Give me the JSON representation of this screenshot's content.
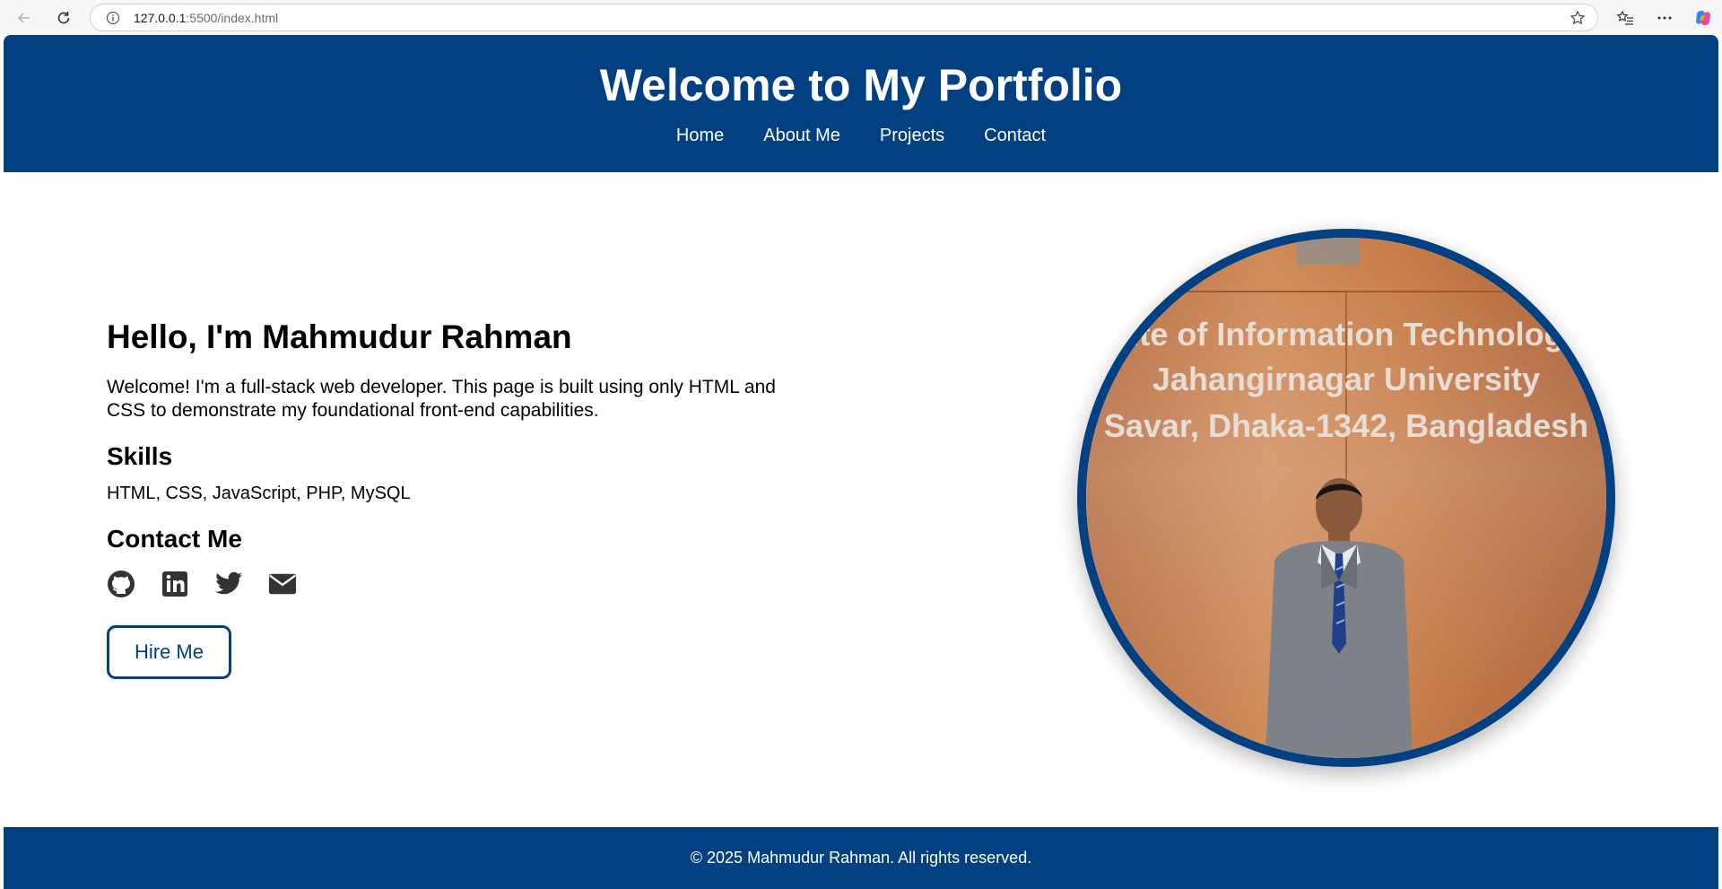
{
  "browser": {
    "url_host": "127.0.0.1",
    "url_rest": ":5500/index.html",
    "icons": [
      "back-arrow-icon",
      "reload-icon",
      "site-info-icon",
      "favorite-star-icon",
      "favorites-icon",
      "more-icon",
      "copilot-icon"
    ]
  },
  "header": {
    "title": "Welcome to My Portfolio",
    "nav": [
      {
        "label": "Home"
      },
      {
        "label": "About Me"
      },
      {
        "label": "Projects"
      },
      {
        "label": "Contact"
      }
    ],
    "background": "#024082"
  },
  "hero": {
    "greeting": "Hello, I'm Mahmudur Rahman",
    "intro": "Welcome! I'm a full-stack web developer. This page is built using only HTML and CSS to demonstrate my foundational front-end capabilities.",
    "skills_title": "Skills",
    "skills": "HTML, CSS, JavaScript, PHP, MySQL",
    "contact_title": "Contact Me",
    "social_icons": [
      "github-icon",
      "linkedin-icon",
      "twitter-icon",
      "envelope-icon"
    ],
    "cta_label": "Hire Me"
  },
  "photo": {
    "sign_lines": [
      "Institute of Information Technology (IIT)",
      "Jahangirnagar University",
      "Savar, Dhaka-1342, Bangladesh"
    ]
  },
  "footer": {
    "text": "© 2025 Mahmudur Rahman. All rights reserved."
  },
  "colors": {
    "brand": "#024082",
    "text": "#000000",
    "social_icon": "#333333"
  }
}
